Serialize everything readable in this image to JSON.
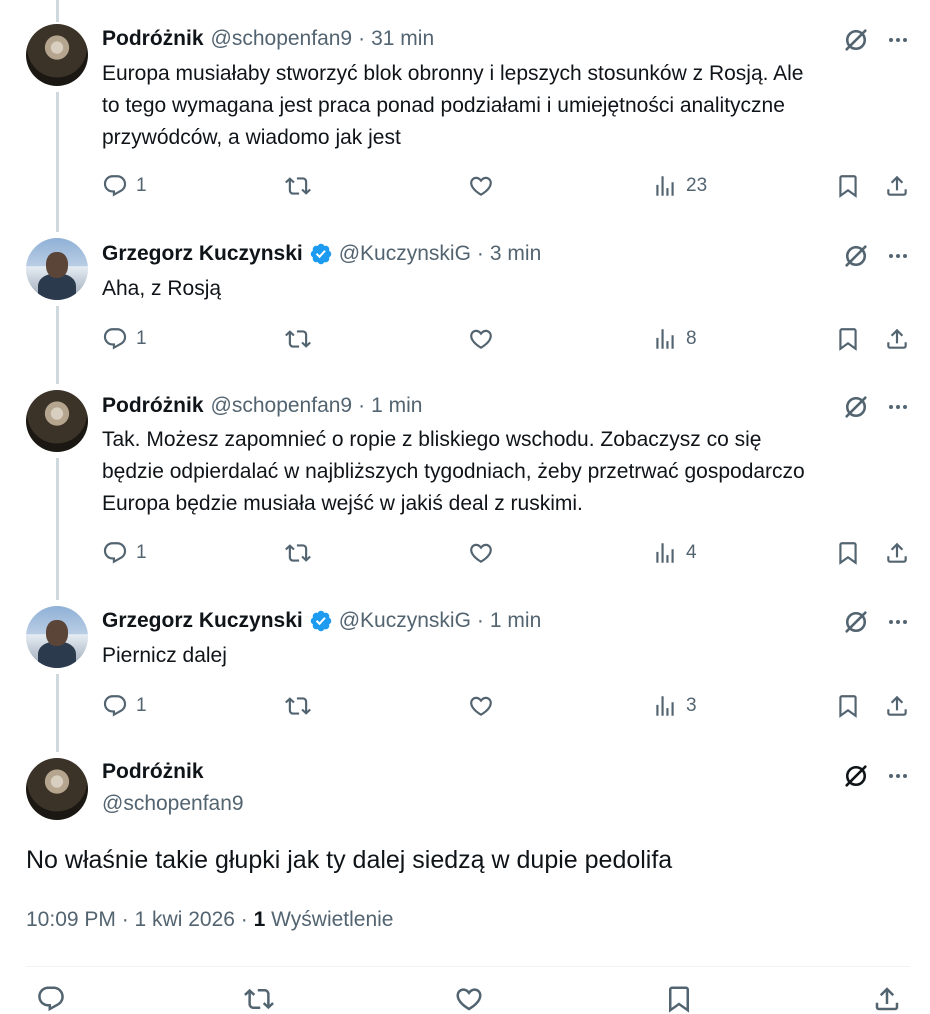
{
  "tweets": [
    {
      "name": "Podróżnik",
      "handle": "@schopenfan9",
      "time": "31 min",
      "text": "Europa musiałaby stworzyć blok obronny i lepszych stosunków z Rosją. Ale\nto tego wymagana jest praca ponad podziałami i umiejętności analityczne\nprzywódców, a wiadomo jak jest",
      "replies": "1",
      "views": "23",
      "avatar": "avatar-podroznik"
    },
    {
      "name": "Grzegorz Kuczynski",
      "handle": "@KuczynskiG",
      "time": "3 min",
      "text": "Aha, z Rosją",
      "replies": "1",
      "views": "8",
      "verified": true,
      "avatar": "avatar-grzegorz"
    },
    {
      "name": "Podróżnik",
      "handle": "@schopenfan9",
      "time": "1 min",
      "text": "Tak. Możesz zapomnieć o ropie z bliskiego wschodu. Zobaczysz co się\nbędzie odpierdalać w najbliższych tygodniach, żeby przetrwać gospodarczo\nEuropa będzie musiała wejść w jakiś deal z ruskimi.",
      "replies": "1",
      "views": "4",
      "avatar": "avatar-podroznik"
    },
    {
      "name": "Grzegorz Kuczynski",
      "handle": "@KuczynskiG",
      "time": "1 min",
      "text": "Piernicz dalej",
      "replies": "1",
      "views": "3",
      "verified": true,
      "avatar": "avatar-grzegorz"
    }
  ],
  "main": {
    "name": "Podróżnik",
    "handle": "@schopenfan9",
    "text": "No właśnie takie głupki jak ty dalej siedzą w dupie pedolifa",
    "date": "10:09 PM · 1 kwi 2026 · ",
    "views_count": "1",
    "views_label": "Wyświetlenie"
  },
  "separator": "·",
  "colors": {
    "text": "#0f1419",
    "secondary": "#536471",
    "verified": "#1d9bf0",
    "thread_line": "#cfd9de"
  }
}
